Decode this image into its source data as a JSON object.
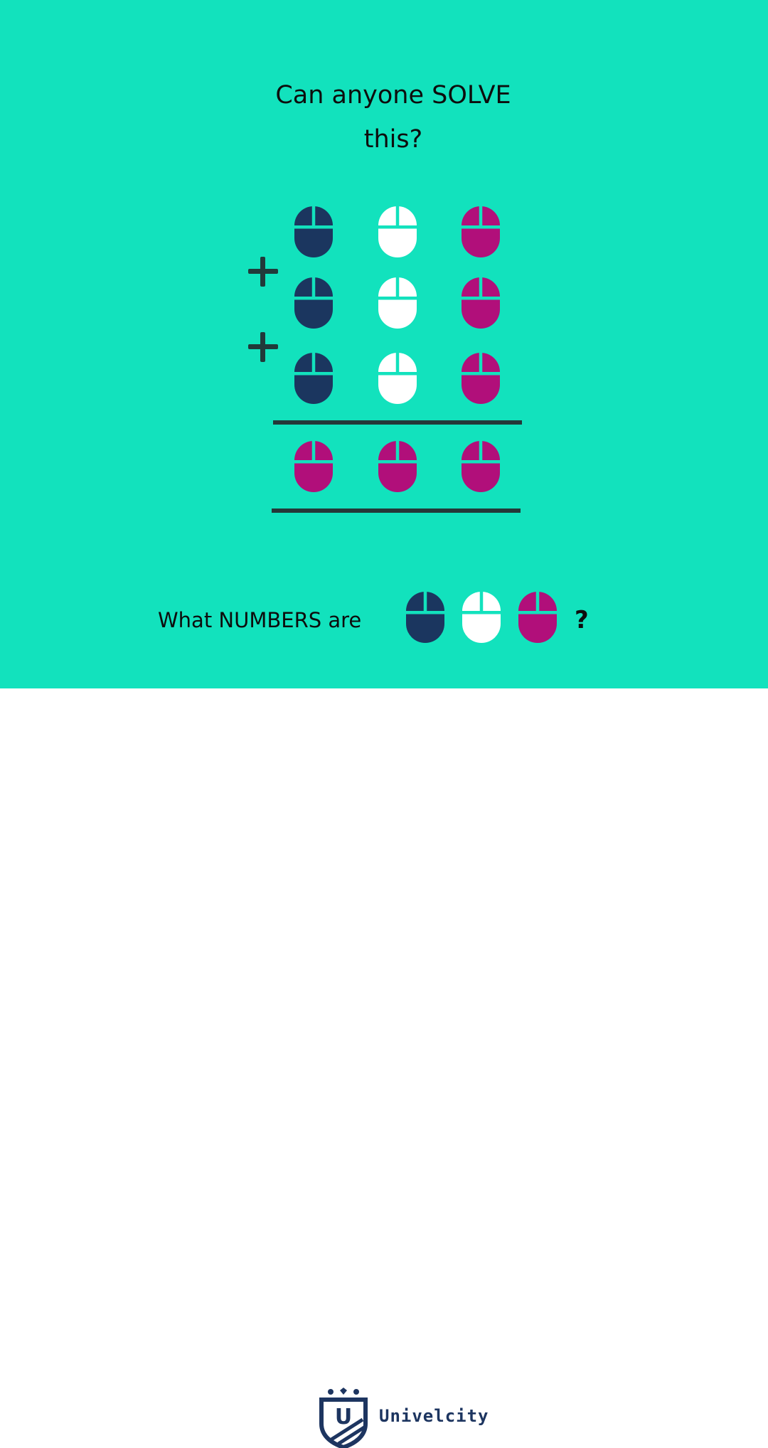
{
  "colors": {
    "background": "#12e2bd",
    "navy": "#1b365f",
    "white": "#ffffff",
    "magenta": "#b10f7a",
    "text": "#0d0d0d",
    "rule": "#243838",
    "brand": "#1d3560"
  },
  "title": {
    "line1": "Can anyone SOLVE",
    "line2": "this?"
  },
  "operators": [
    "+",
    "+"
  ],
  "puzzle": {
    "addend_rows": [
      [
        "navy",
        "white",
        "magenta"
      ],
      [
        "navy",
        "white",
        "magenta"
      ],
      [
        "navy",
        "white",
        "magenta"
      ]
    ],
    "result_row": [
      "magenta",
      "magenta",
      "magenta"
    ]
  },
  "question": {
    "text": "What NUMBERS are",
    "icons": [
      "navy",
      "white",
      "magenta"
    ],
    "end": "?"
  },
  "brand": {
    "name": "Univelcity",
    "logo_letter": "U",
    "logo_icon": "shield-crown-icon"
  }
}
